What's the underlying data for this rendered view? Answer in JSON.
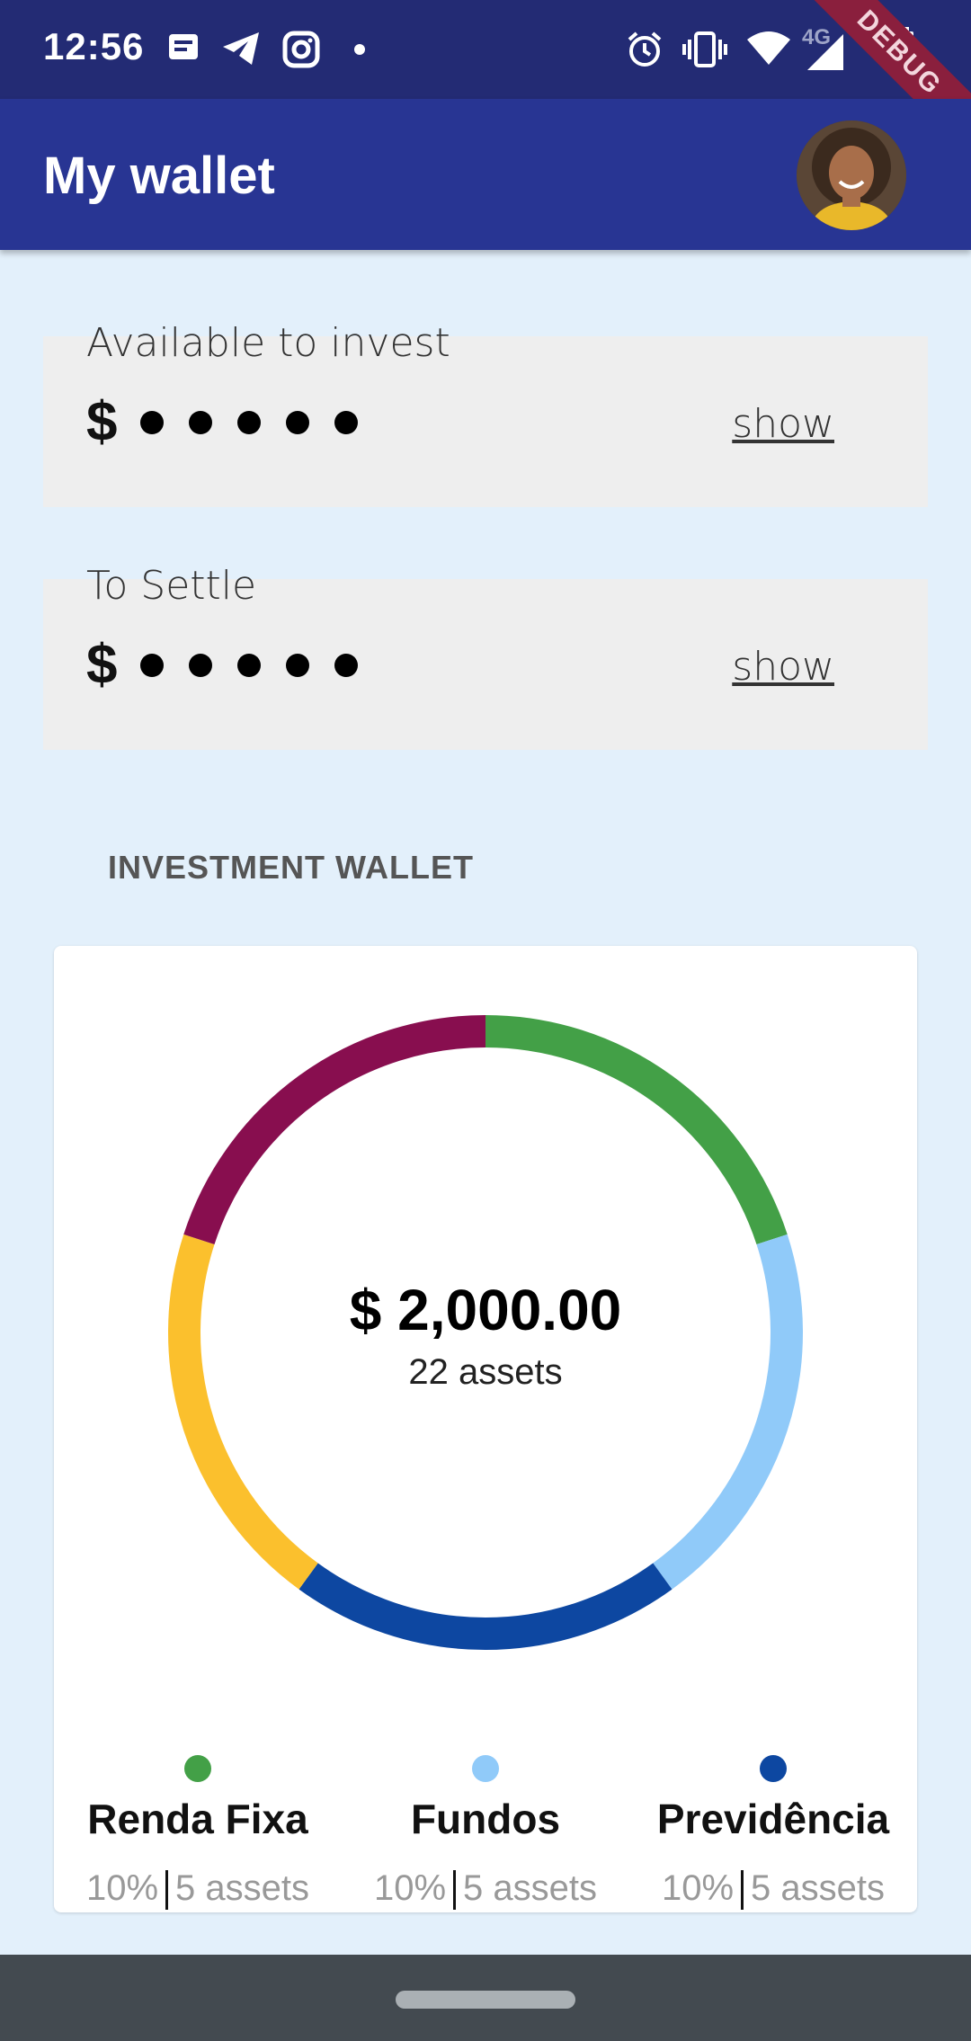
{
  "status_bar": {
    "time": "12:56",
    "left_icons": [
      "message-icon",
      "telegram-icon",
      "instagram-icon",
      "dot-icon"
    ],
    "right_icons": [
      "alarm-icon",
      "vibrate-icon",
      "wifi-icon",
      "signal-icon",
      "battery-icon"
    ],
    "network": "4G",
    "debug_label": "DEBUG"
  },
  "app_bar": {
    "title": "My wallet",
    "background": "#283593"
  },
  "available": {
    "label": "Available to invest",
    "currency": "$",
    "show_label": "show"
  },
  "to_settle": {
    "label": "To Settle",
    "currency": "$",
    "show_label": "show"
  },
  "investment_wallet": {
    "section_title": "INVESTMENT WALLET",
    "total": "$ 2,000.00",
    "assets": "22 assets"
  },
  "chart_data": {
    "type": "pie",
    "donut": true,
    "center_text": [
      "$ 2,000.00",
      "22 assets"
    ],
    "series": [
      {
        "name": "Renda Fixa",
        "value": 1,
        "color": "#43a047"
      },
      {
        "name": "Fundos",
        "value": 1,
        "color": "#90caf9"
      },
      {
        "name": "Previdência",
        "value": 1,
        "color": "#0d47a1"
      },
      {
        "name": "",
        "value": 1,
        "color": "#fbc02d"
      },
      {
        "name": "",
        "value": 1,
        "color": "#880e4f"
      }
    ]
  },
  "legend": [
    {
      "name": "Renda Fixa",
      "percent": "10%",
      "assets": "5 assets",
      "color": "#43a047"
    },
    {
      "name": "Fundos",
      "percent": "10%",
      "assets": "5 assets",
      "color": "#90caf9"
    },
    {
      "name": "Previdência",
      "percent": "10%",
      "assets": "5 assets",
      "color": "#0d47a1"
    }
  ]
}
